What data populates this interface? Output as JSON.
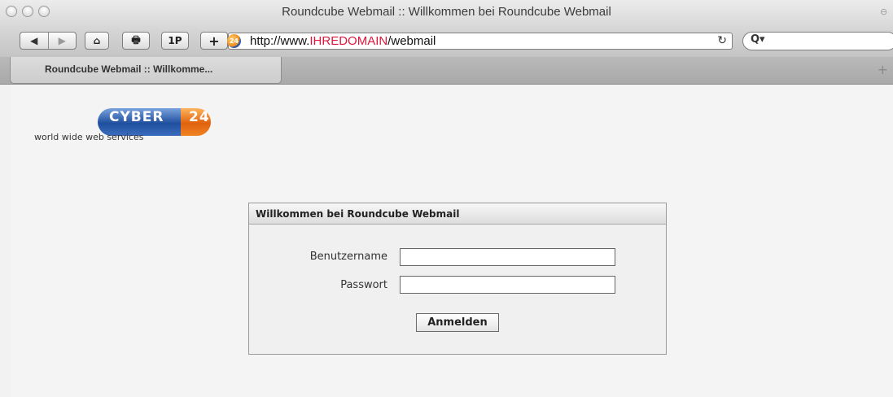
{
  "window": {
    "title": "Roundcube Webmail :: Willkommen bei Roundcube Webmail"
  },
  "toolbar": {
    "back_icon": "◀",
    "forward_icon": "▶",
    "home_icon": "⌂",
    "print_icon": "🖶",
    "onepassword_label": "1P",
    "add_icon": "+",
    "url_prefix": "http://www.",
    "url_domain": "IHREDOMAIN",
    "url_path": "/webmail",
    "reload_icon": "↻",
    "search_icon": "Q▾"
  },
  "tabs": {
    "active_label": "Roundcube Webmail :: Willkomme...",
    "new_tab_icon": "+"
  },
  "logo": {
    "text_left": "CYBER",
    "text_right": "24",
    "tagline": "world wide web services"
  },
  "login": {
    "title": "Willkommen bei Roundcube Webmail",
    "username_label": "Benutzername",
    "username_value": "",
    "password_label": "Passwort",
    "password_value": "",
    "submit_label": "Anmelden"
  },
  "colors": {
    "url_domain": "#e0153b",
    "logo_blue": "#1f4f9e",
    "logo_orange": "#e0620e"
  }
}
